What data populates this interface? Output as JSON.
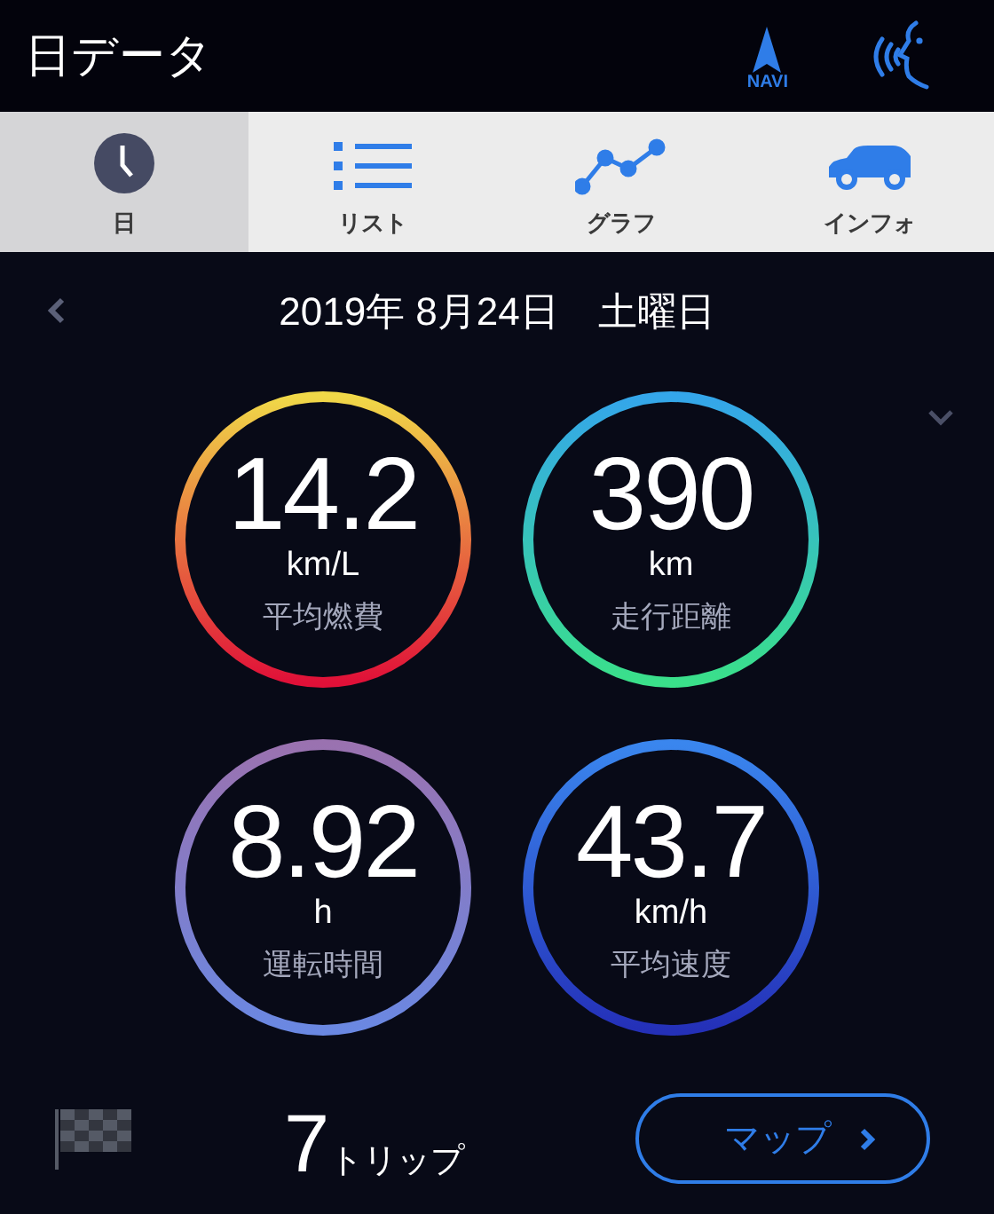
{
  "header": {
    "title": "日データ",
    "navi_label": "NAVI"
  },
  "tabs": [
    {
      "label": "日",
      "kind": "clock",
      "selected": true
    },
    {
      "label": "リスト",
      "kind": "list",
      "selected": false
    },
    {
      "label": "グラフ",
      "kind": "graph",
      "selected": false
    },
    {
      "label": "インフォ",
      "kind": "car",
      "selected": false
    }
  ],
  "date": "2019年 8月24日　土曜日",
  "metrics": [
    {
      "value": "14.2",
      "unit": "km/L",
      "label": "平均燃費",
      "color": "#f0d848"
    },
    {
      "value": "390",
      "unit": "km",
      "label": "走行距離",
      "color": "#34a6ea"
    },
    {
      "value": "8.92",
      "unit": "h",
      "label": "運転時間",
      "color": "#9a72b0"
    },
    {
      "value": "43.7",
      "unit": "km/h",
      "label": "平均速度",
      "color": "#3a86ee"
    }
  ],
  "trips": {
    "count": "7",
    "suffix": "トリップ"
  },
  "map_button": "マップ"
}
